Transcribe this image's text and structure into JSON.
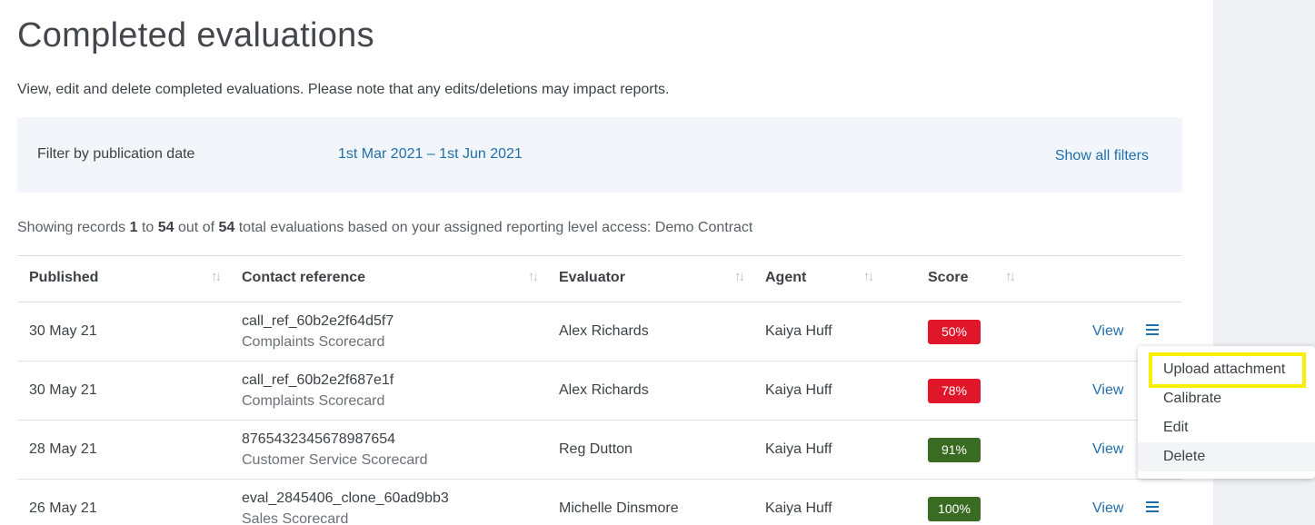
{
  "page": {
    "title": "Completed evaluations",
    "intro": "View, edit and delete completed evaluations. Please note that any edits/deletions may impact reports."
  },
  "filter": {
    "label": "Filter by publication date",
    "date_range": "1st Mar 2021 – 1st Jun 2021",
    "show_all": "Show all filters"
  },
  "records": {
    "prefix": "Showing records ",
    "from": "1",
    "to_word": " to ",
    "to": "54",
    "out_of_word": " out of ",
    "total": "54",
    "suffix": " total evaluations based on your assigned reporting level access: Demo Contract"
  },
  "table": {
    "columns": {
      "published": "Published",
      "contact_reference": "Contact reference",
      "evaluator": "Evaluator",
      "agent": "Agent",
      "score": "Score"
    },
    "sort_glyph": "↑↓",
    "view_label": "View",
    "rows": [
      {
        "published": "30 May 21",
        "reference": "call_ref_60b2e2f64d5f7",
        "scorecard": "Complaints Scorecard",
        "evaluator": "Alex Richards",
        "agent": "Kaiya Huff",
        "score": "50%",
        "score_color": "#e0162b"
      },
      {
        "published": "30 May 21",
        "reference": "call_ref_60b2e2f687e1f",
        "scorecard": "Complaints Scorecard",
        "evaluator": "Alex Richards",
        "agent": "Kaiya Huff",
        "score": "78%",
        "score_color": "#e0162b"
      },
      {
        "published": "28 May 21",
        "reference": "8765432345678987654",
        "scorecard": "Customer Service Scorecard",
        "evaluator": "Reg Dutton",
        "agent": "Kaiya Huff",
        "score": "91%",
        "score_color": "#3a6b23"
      },
      {
        "published": "26 May 21",
        "reference": "eval_2845406_clone_60ad9bb3",
        "scorecard": "Sales Scorecard",
        "evaluator": "Michelle Dinsmore",
        "agent": "Kaiya Huff",
        "score": "100%",
        "score_color": "#3a6b23"
      }
    ]
  },
  "menu": {
    "items": [
      "Upload attachment",
      "Calibrate",
      "Edit",
      "Delete"
    ]
  },
  "colors": {
    "link": "#1f6fae",
    "highlight": "#f7f000",
    "fail": "#e0162b",
    "pass": "#3a6b23"
  }
}
